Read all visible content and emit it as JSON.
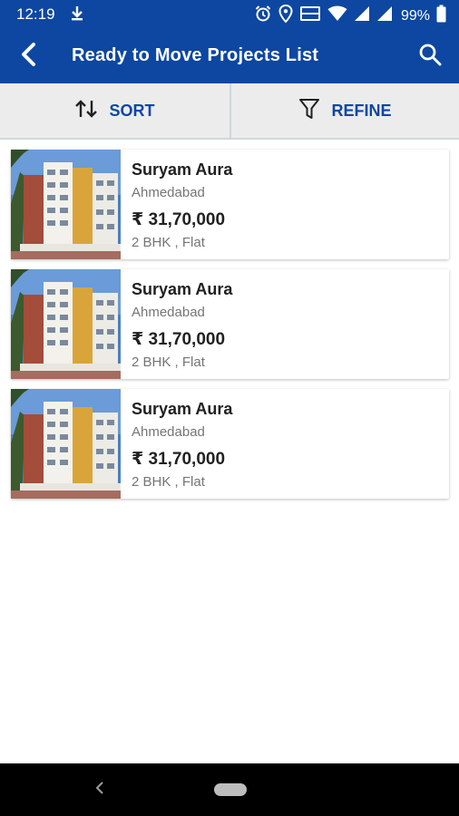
{
  "status_bar": {
    "time": "12:19",
    "battery_pct": "99%",
    "icons": [
      "download-icon",
      "alarm-icon",
      "location-icon",
      "volte-icon",
      "wifi-icon",
      "signal-icon",
      "signal-icon",
      "battery-icon"
    ]
  },
  "app_bar": {
    "title": "Ready to Move Projects List",
    "back_icon": "back-arrow-icon",
    "search_icon": "search-icon"
  },
  "actions": {
    "sort_label": "SORT",
    "refine_label": "REFINE"
  },
  "colors": {
    "primary": "#0d47a1",
    "toolbar_bg": "#ececec",
    "text_dark": "#212121",
    "text_muted": "#757575"
  },
  "projects": [
    {
      "name": "Suryam Aura",
      "city": "Ahmedabad",
      "price": "₹ 31,70,000",
      "type": "2 BHK , Flat"
    },
    {
      "name": "Suryam Aura",
      "city": "Ahmedabad",
      "price": "₹ 31,70,000",
      "type": "2 BHK , Flat"
    },
    {
      "name": "Suryam Aura",
      "city": "Ahmedabad",
      "price": "₹ 31,70,000",
      "type": "2 BHK , Flat"
    }
  ]
}
